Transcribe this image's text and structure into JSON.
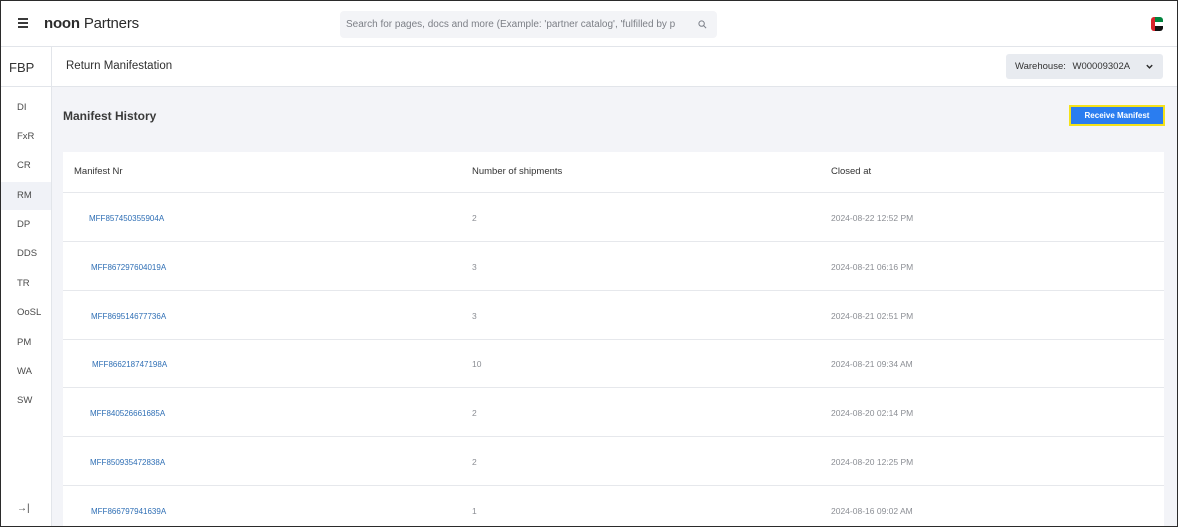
{
  "topbar": {
    "logo_bold": "noon",
    "logo_rest": " Partners",
    "search_placeholder": "Search for pages, docs and more (Example: 'partner catalog', 'fulfilled by p"
  },
  "sidebar": {
    "header": "FBP",
    "items": [
      {
        "label": "DI"
      },
      {
        "label": "FxR"
      },
      {
        "label": "CR"
      },
      {
        "label": "RM"
      },
      {
        "label": "DP"
      },
      {
        "label": "DDS"
      },
      {
        "label": "TR"
      },
      {
        "label": "OoSL"
      },
      {
        "label": "PM"
      },
      {
        "label": "WA"
      },
      {
        "label": "SW"
      }
    ],
    "active": "RM",
    "collapse_label": "→|"
  },
  "subheader": {
    "title": "Return Manifestation",
    "warehouse_label": "Warehouse:",
    "warehouse_value": "W00009302A"
  },
  "main": {
    "section_title": "Manifest History",
    "receive_button": "Receive Manifest",
    "table": {
      "headers": [
        "Manifest Nr",
        "Number of shipments",
        "Closed at"
      ],
      "rows": [
        {
          "manifest": "MFF857450355904A",
          "shipments": "2",
          "closed_at": "2024-08-22 12:52 PM"
        },
        {
          "manifest": "MFF867297604019A",
          "shipments": "3",
          "closed_at": "2024-08-21 06:16 PM"
        },
        {
          "manifest": "MFF869514677736A",
          "shipments": "3",
          "closed_at": "2024-08-21 02:51 PM"
        },
        {
          "manifest": "MFF866218747198A",
          "shipments": "10",
          "closed_at": "2024-08-21 09:34 AM"
        },
        {
          "manifest": "MFF840526661685A",
          "shipments": "2",
          "closed_at": "2024-08-20 02:14 PM"
        },
        {
          "manifest": "MFF850935472838A",
          "shipments": "2",
          "closed_at": "2024-08-20 12:25 PM"
        },
        {
          "manifest": "MFF866797941639A",
          "shipments": "1",
          "closed_at": "2024-08-16 09:02 AM"
        }
      ]
    }
  },
  "colors": {
    "accent": "#2a7df0",
    "highlight_border": "#f4e21a",
    "link": "#2f6fb5",
    "content_bg": "#f3f4f8"
  }
}
